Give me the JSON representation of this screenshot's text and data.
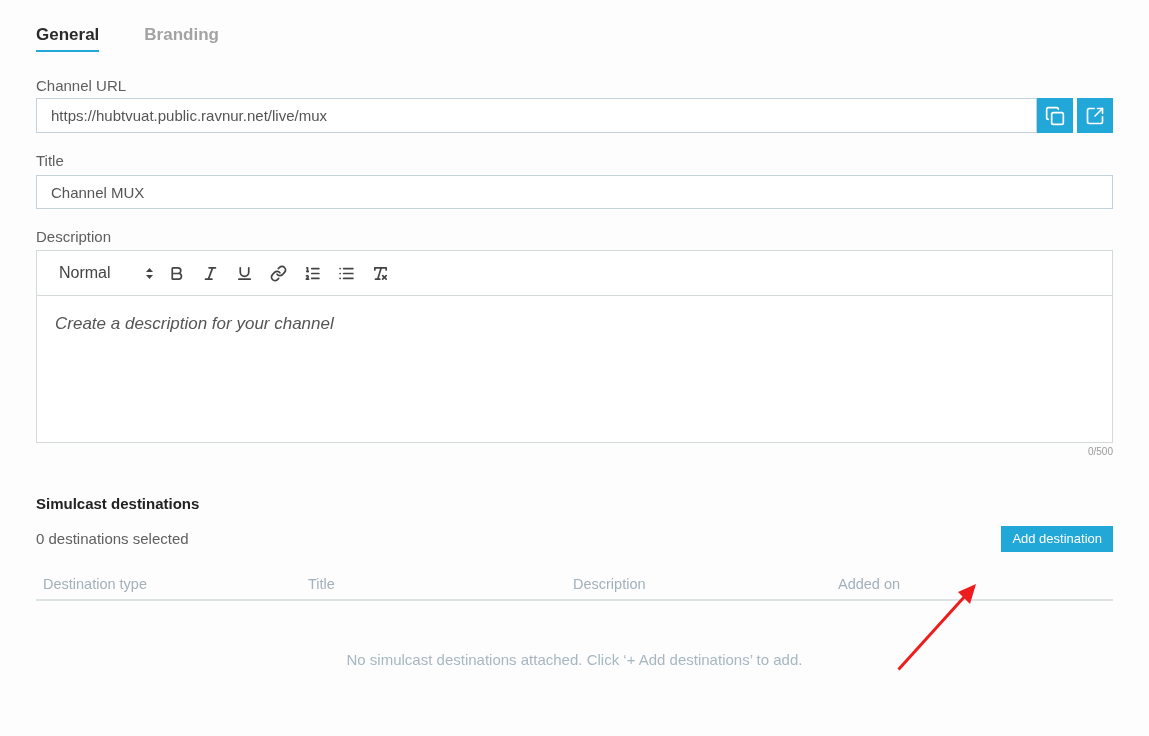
{
  "tabs": [
    {
      "label": "General",
      "selected": true
    },
    {
      "label": "Branding",
      "selected": false
    }
  ],
  "channel_url": {
    "label": "Channel URL",
    "value": "https://hubtvuat.public.ravnur.net/live/mux"
  },
  "title": {
    "label": "Title",
    "value": "Channel MUX"
  },
  "description": {
    "label": "Description",
    "format": "Normal",
    "placeholder": "Create a description for your channel",
    "counter": "0/500"
  },
  "simulcast": {
    "heading": "Simulcast destinations",
    "selected_count": "0 destinations selected",
    "add_button": "Add destination",
    "table": {
      "columns": [
        "Destination type",
        "Title",
        "Description",
        "Added on"
      ],
      "empty_message": "No simulcast destinations attached. Click ‘+ Add destinations’ to add."
    }
  },
  "annotations": [
    {
      "kind": "arrow"
    }
  ]
}
